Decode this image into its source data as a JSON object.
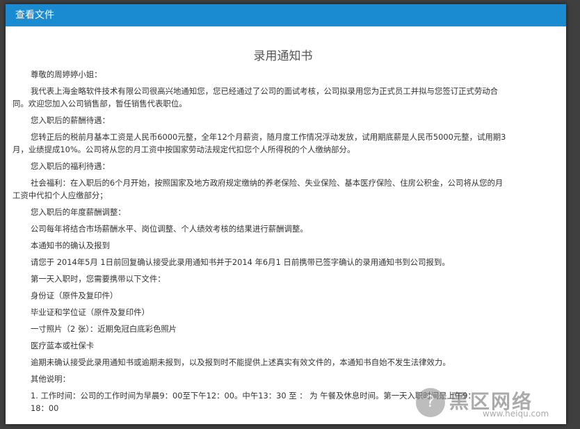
{
  "window": {
    "title": "查看文件"
  },
  "doc": {
    "title": "录用通知书",
    "lines": [
      "尊敬的周婷婷小姐：",
      "我代表上海金略软件技术有限公司很高兴地通知您，您已经通过了公司的面试考核，公司拟录用您为正式员工并拟与您签订正式劳动合",
      "同。欢迎您加入公司销售部，暂任销售代表职位。",
      "您入职后的薪酬待遇：",
      "您转正后的税前月基本工资是人民币6000元整，全年12个月薪资，随月度工作情况浮动发放，试用期底薪是人民币5000元整，试用期3",
      "月，业绩提成10%。公司将从您的月工资中按国家劳动法规定代扣您个人所得税的个人缴纳部分。",
      "您入职后的福利待遇：",
      "社会福利：在入职后的6个月开始，按照国家及地方政府规定缴纳的养老保险、失业保险、基本医疗保险、住房公积金，公司将从您的月",
      "工资中代扣个人应缴部分；",
      "您入职后的年度薪酬调整：",
      "公司每年将结合市场薪酬水平、岗位调整、个人绩效考核的结果进行薪酬调整。",
      "本通知书的确认及报到",
      "请您于  2014年5月  1日前回复确认接受此录用通知书并于2014 年6月1 日前携带已签字确认的录用通知书到公司报到。",
      "第一天入职时，您需要携带以下文件：",
      "身份证（原件及复印件）",
      "毕业证和学位证（原件及复印件）",
      "一寸照片（2 张）：近期免冠白底彩色照片",
      "医疗蓝本或社保卡",
      "逾期未确认接受此录用通知书或逾期未报到，以及报到时不能提供上述真实有效文件的，本通知书自始不发生法律效力。",
      "其他说明：",
      "1. 工作时间：公司的工作时间为早晨9：00至下午12：00。中午13：30 至 ：  为 午餐及休息时间。第一天入职时间是上午9：",
      "18：00"
    ]
  },
  "watermark": {
    "glyph": "?",
    "text": "黑区网络",
    "url": "www.heiqu.com"
  }
}
